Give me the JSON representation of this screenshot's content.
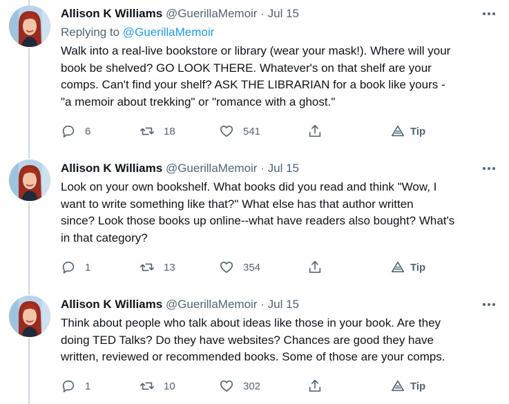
{
  "tweets": [
    {
      "author_name": "Allison K Williams",
      "handle": "@GuerillaMemoir",
      "separator": "·",
      "date": "Jul 15",
      "replying_prefix": "Replying to",
      "replying_to": "@GuerillaMemoir",
      "text_lines": [
        "Walk into a real-live bookstore or library (wear your mask!). Where will your",
        "book be shelved? GO LOOK THERE. Whatever's on that shelf are your",
        "comps. Can't find your shelf? ASK THE LIBRARIAN for a book like yours -",
        "\"a memoir about trekking\" or \"romance with a ghost.\""
      ],
      "replies": "6",
      "retweets": "18",
      "likes": "541",
      "tip_label": "Tip"
    },
    {
      "author_name": "Allison K Williams",
      "handle": "@GuerillaMemoir",
      "separator": "·",
      "date": "Jul 15",
      "text_lines": [
        "Look on your own bookshelf. What books did you read and think \"Wow, I",
        "want to write something like that?\" What else has that author written",
        "since? Look those books up online--what have readers also bought? What's",
        "in that category?"
      ],
      "replies": "1",
      "retweets": "13",
      "likes": "354",
      "tip_label": "Tip"
    },
    {
      "author_name": "Allison K Williams",
      "handle": "@GuerillaMemoir",
      "separator": "·",
      "date": "Jul 15",
      "text_lines": [
        "Think about people who talk about ideas like those in your book. Are they",
        "doing TED Talks? Do they have websites? Chances are good they have",
        "written, reviewed or recommended books. Some of those are your comps."
      ],
      "replies": "1",
      "retweets": "10",
      "likes": "302",
      "tip_label": "Tip"
    }
  ],
  "icons": {
    "reply": "reply-icon",
    "retweet": "retweet-icon",
    "like": "heart-icon",
    "share": "share-icon",
    "tip": "tip-icon",
    "more": "more-options-icon"
  },
  "colors": {
    "text": "#0f1419",
    "secondary": "#536471",
    "link": "#1d9bf0",
    "thread_line": "#cfd9de"
  }
}
